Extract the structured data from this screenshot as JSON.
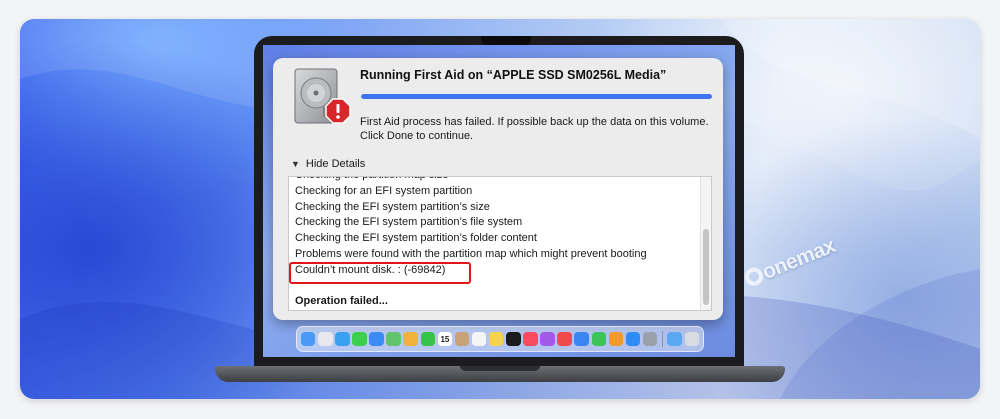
{
  "dialog": {
    "title": "Running First Aid on “APPLE SSD SM0256L Media”",
    "progress": 1.0,
    "message": "First Aid process has failed. If possible back up the data on this volume. Click Done to continue.",
    "toggle_label": "Hide Details",
    "log_lines": [
      "Checking the partition map size",
      "Checking for an EFI system partition",
      "Checking the EFI system partition’s size",
      "Checking the EFI system partition’s file system",
      "Checking the EFI system partition’s folder content",
      "Problems were found with the partition map which might prevent booting",
      "Couldn’t mount disk. : (-69842)",
      "",
      "Operation failed..."
    ],
    "highlighted_line_index": 6,
    "highlight_color": "#e0161a",
    "accent_color": "#3f73f2"
  },
  "dock": {
    "apps": [
      {
        "icon": "finder-icon",
        "color": "#4a9af5"
      },
      {
        "icon": "launchpad-icon",
        "color": "#e8e8ee"
      },
      {
        "icon": "safari-icon",
        "color": "#3aa0f0"
      },
      {
        "icon": "messages-icon",
        "color": "#3ccf4e"
      },
      {
        "icon": "mail-icon",
        "color": "#3b8cf2"
      },
      {
        "icon": "maps-icon",
        "color": "#62c46a"
      },
      {
        "icon": "photos-icon",
        "color": "#f0b23a"
      },
      {
        "icon": "facetime-icon",
        "color": "#37c24a"
      },
      {
        "icon": "calendar-icon",
        "color": "#ffffff"
      },
      {
        "icon": "contacts-icon",
        "color": "#c9a27a"
      },
      {
        "icon": "reminders-icon",
        "color": "#f5f5f5"
      },
      {
        "icon": "notes-icon",
        "color": "#f7d24c"
      },
      {
        "icon": "tv-icon",
        "color": "#1b1b1d"
      },
      {
        "icon": "music-icon",
        "color": "#fa4a5f"
      },
      {
        "icon": "podcasts-icon",
        "color": "#a259e6"
      },
      {
        "icon": "news-icon",
        "color": "#f04a4a"
      },
      {
        "icon": "keynote-icon",
        "color": "#3a86f0"
      },
      {
        "icon": "numbers-icon",
        "color": "#3cc35a"
      },
      {
        "icon": "pages-icon",
        "color": "#f39a2e"
      },
      {
        "icon": "app-store-icon",
        "color": "#2f8cf5"
      },
      {
        "icon": "system-settings-icon",
        "color": "#9aa0a8"
      },
      {
        "icon": "downloads-folder-icon",
        "color": "#5aa8f2"
      },
      {
        "icon": "trash-icon",
        "color": "#d8dbe0"
      }
    ],
    "separator_after": 20
  },
  "calendar_day": "15",
  "watermark": "Donemax"
}
